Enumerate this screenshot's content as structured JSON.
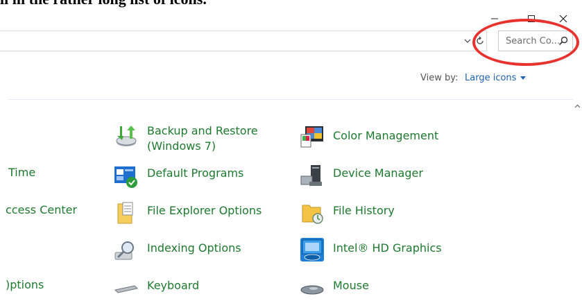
{
  "banner": {
    "text": "ll in the rather long list of icons."
  },
  "window": {
    "minimize_label": "—",
    "maximize_label": "□",
    "close_label": "✕"
  },
  "search": {
    "placeholder": "Search Co...",
    "icon": "search-icon"
  },
  "view_by": {
    "label": "View by:",
    "value": "Large icons"
  },
  "left_column": {
    "items": [
      {
        "label": "Time"
      },
      {
        "label": "ccess Center"
      },
      {
        "label": ")ptions"
      }
    ]
  },
  "middle_column": {
    "items": [
      {
        "label_line1": "Backup and Restore",
        "label_line2": "(Windows 7)",
        "icon": "backup-restore-icon"
      },
      {
        "label": "Default Programs",
        "icon": "default-programs-icon"
      },
      {
        "label": "File Explorer Options",
        "icon": "file-explorer-options-icon"
      },
      {
        "label": "Indexing Options",
        "icon": "indexing-options-icon"
      },
      {
        "label": "Keyboard",
        "icon": "keyboard-icon"
      }
    ]
  },
  "right_column": {
    "items": [
      {
        "label": "Color Management",
        "icon": "color-management-icon"
      },
      {
        "label": "Device Manager",
        "icon": "device-manager-icon"
      },
      {
        "label": "File History",
        "icon": "file-history-icon"
      },
      {
        "label": "Intel® HD Graphics",
        "icon": "intel-graphics-icon"
      },
      {
        "label": "Mouse",
        "icon": "mouse-icon"
      }
    ]
  },
  "colors": {
    "link_green": "#1d7a2e",
    "link_blue": "#1f63b0",
    "highlight_red": "#e8322e"
  }
}
